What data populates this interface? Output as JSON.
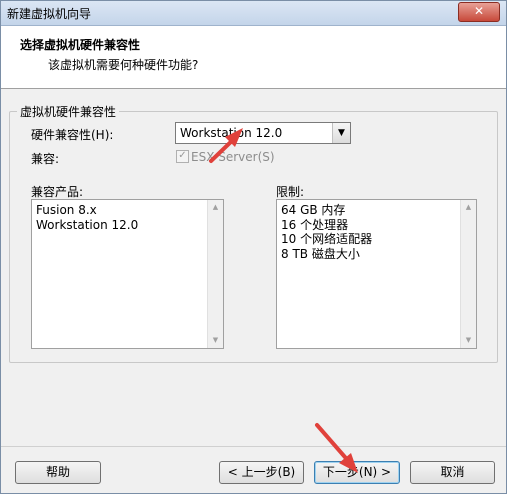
{
  "window": {
    "title": "新建虚拟机向导",
    "close_label": "✕"
  },
  "header": {
    "title": "选择虚拟机硬件兼容性",
    "subtitle": "该虚拟机需要何种硬件功能?"
  },
  "group": {
    "label": "虚拟机硬件兼容性",
    "compat_label": "硬件兼容性(H):",
    "compat_value": "Workstation 12.0",
    "compatible_label": "兼容:",
    "esx_label": "ESX Server(S)",
    "esx_checked": true
  },
  "products": {
    "label": "兼容产品:",
    "items": [
      "Fusion 8.x",
      "Workstation 12.0"
    ]
  },
  "limits": {
    "label": "限制:",
    "items": [
      "64 GB 内存",
      "16 个处理器",
      "10 个网络适配器",
      "8 TB 磁盘大小"
    ]
  },
  "buttons": {
    "help": "帮助",
    "back": "< 上一步(B)",
    "next": "下一步(N) >",
    "cancel": "取消"
  },
  "colors": {
    "annotation": "#e0413b"
  }
}
